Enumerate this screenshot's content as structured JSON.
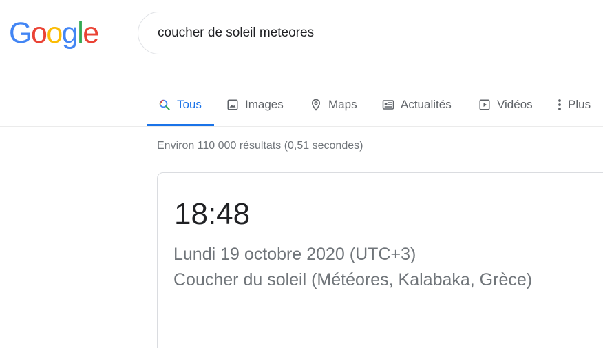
{
  "logo": {
    "letters": [
      "G",
      "o",
      "o",
      "g",
      "l",
      "e"
    ],
    "colors": [
      "#4285f4",
      "#ea4335",
      "#fbbc05",
      "#4285f4",
      "#34a853",
      "#ea4335"
    ]
  },
  "search": {
    "value": "coucher de soleil meteores"
  },
  "tabs": [
    {
      "label": "Tous",
      "icon": "search-icon",
      "active": true
    },
    {
      "label": "Images",
      "icon": "image-icon",
      "active": false
    },
    {
      "label": "Maps",
      "icon": "map-pin-icon",
      "active": false
    },
    {
      "label": "Actualités",
      "icon": "news-icon",
      "active": false
    },
    {
      "label": "Vidéos",
      "icon": "video-icon",
      "active": false
    },
    {
      "label": "Plus",
      "icon": "more-vert-icon",
      "active": false
    }
  ],
  "result_stats": "Environ 110 000 résultats (0,51 secondes)",
  "answer_card": {
    "time": "18:48",
    "date": "Lundi 19 octobre 2020 (UTC+3)",
    "description": "Coucher du soleil (Météores, Kalabaka, Grèce)"
  },
  "colors": {
    "accent": "#1a73e8",
    "tab_text": "#5f6368",
    "secondary_text": "#70757a",
    "primary_text": "#202124"
  }
}
